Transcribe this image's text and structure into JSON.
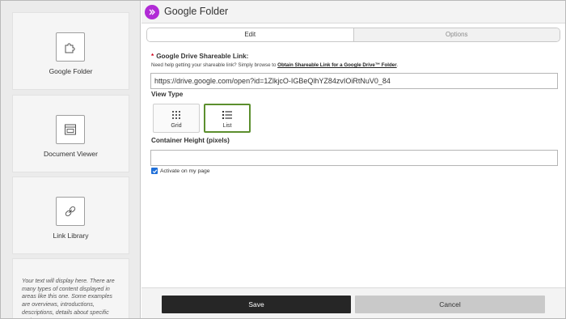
{
  "sidebar": {
    "widgets": [
      {
        "label": "Google Folder",
        "icon": "puzzle-icon"
      },
      {
        "label": "Document Viewer",
        "icon": "document-viewer-icon"
      },
      {
        "label": "Link Library",
        "icon": "link-icon"
      }
    ],
    "note_text": "Your text will display here. There are many types of content displayed in areas like this one. Some examples are overviews, introductions, descriptions, details about specific topics etc."
  },
  "header": {
    "title": "Google Folder",
    "badge_icon": "double-chevron-right-icon",
    "badge_color": "#b12bd6"
  },
  "tabs": [
    {
      "label": "Edit",
      "active": true
    },
    {
      "label": "Options",
      "active": false
    }
  ],
  "form": {
    "shareable_link_label": "Google Drive Shareable Link:",
    "required_marker": "*",
    "help_text": "Need help getting your shareable link? Simply browse to ",
    "help_link": "Obtain Shareable Link for a Google Drive™ Folder",
    "help_suffix": ".",
    "shareable_link_value": "https://drive.google.com/open?id=1ZlkjcO-IGBeQlhYZ84zvIOiRtNuV0_84",
    "view_type_label": "View Type",
    "view_types": [
      {
        "label": "Grid",
        "icon": "grid-icon",
        "selected": false
      },
      {
        "label": "List",
        "icon": "list-icon",
        "selected": true
      }
    ],
    "container_height_label": "Container Height (pixels)",
    "container_height_value": "",
    "activate_label": "Activate on my page",
    "activate_checked": true
  },
  "footer": {
    "save_label": "Save",
    "cancel_label": "Cancel"
  },
  "colors": {
    "selected_border": "#5c8f2e",
    "checkbox": "#1f6fd8",
    "required": "#d0021b"
  }
}
